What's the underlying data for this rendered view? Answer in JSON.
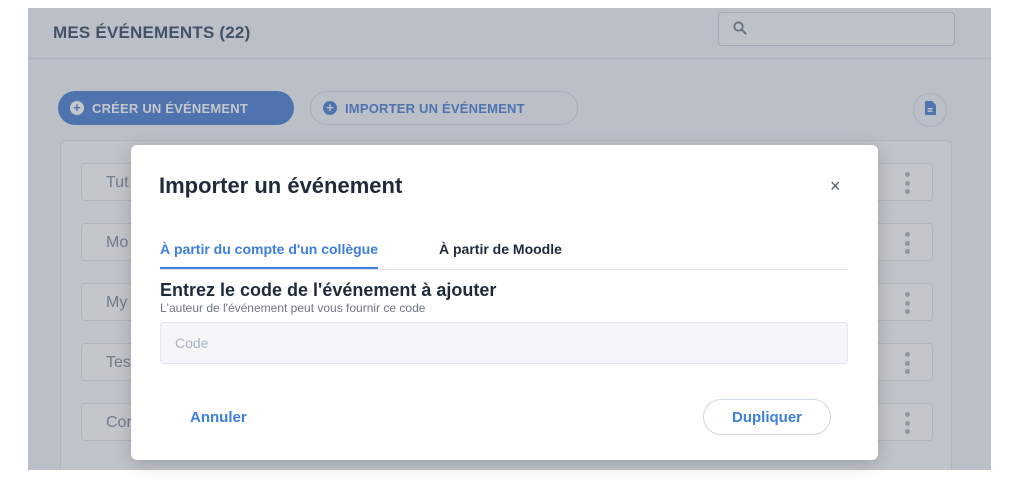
{
  "header": {
    "title": "MES ÉVÉNEMENTS (22)",
    "search_placeholder": ""
  },
  "toolbar": {
    "create_label": "CRÉER UN ÉVÉNEMENT",
    "import_label": "IMPORTER UN ÉVÉNEMENT"
  },
  "events": [
    {
      "name": "Tut"
    },
    {
      "name": "Mo"
    },
    {
      "name": "My"
    },
    {
      "name": "Tes"
    },
    {
      "name": "Cor"
    }
  ],
  "modal": {
    "title": "Importer un événement",
    "close_symbol": "×",
    "tabs": [
      {
        "label": "À partir du compte d'un collègue",
        "active": true
      },
      {
        "label": "À partir de Moodle",
        "active": false
      }
    ],
    "section_title": "Entrez le code de l'événement à ajouter",
    "section_subtitle": "L'auteur de l'événement peut vous fournir ce code",
    "code_placeholder": "Code",
    "code_value": "",
    "cancel_label": "Annuler",
    "duplicate_label": "Dupliquer"
  },
  "colors": {
    "accent": "#3d7ee0",
    "header_text": "#4f5f73",
    "overlay": "rgba(40,52,70,0.28)"
  },
  "icons": {
    "search": "search-icon",
    "plus": "plus-circle-icon",
    "document": "document-icon",
    "more": "kebab-menu-icon",
    "close": "close-icon"
  }
}
